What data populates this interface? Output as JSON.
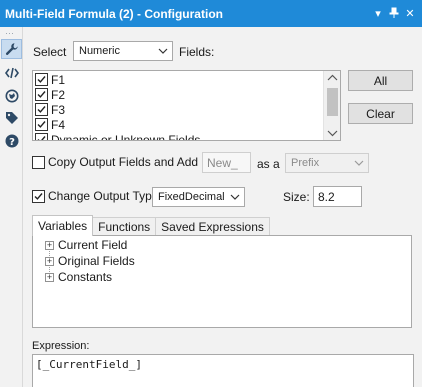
{
  "window": {
    "title": "Multi-Field Formula (2) - Configuration",
    "controls": [
      "▾",
      "⊥",
      "✕"
    ]
  },
  "sidebar": {
    "grip": "⋯",
    "icons": [
      "wrench-icon",
      "code-icon",
      "globe-icon",
      "tag-icon",
      "help-icon"
    ]
  },
  "select_row": {
    "label": "Select",
    "type_value": "Numeric",
    "fields_label": "Fields:"
  },
  "fields": {
    "items": [
      {
        "label": "F1",
        "checked": true
      },
      {
        "label": "F2",
        "checked": true
      },
      {
        "label": "F3",
        "checked": true
      },
      {
        "label": "F4",
        "checked": true
      },
      {
        "label": "Dynamic or Unknown Fields",
        "checked": true
      }
    ],
    "all_button": "All",
    "clear_button": "Clear"
  },
  "copy_output": {
    "label": "Copy Output Fields and Add",
    "checked": false,
    "text_value": "New_",
    "as_label": "as a",
    "position_value": "Prefix"
  },
  "change_type": {
    "label": "Change Output Type to",
    "checked": true,
    "type_value": "FixedDecimal",
    "size_label": "Size:",
    "size_value": "8.2"
  },
  "tabs": [
    {
      "label": "Variables",
      "active": true
    },
    {
      "label": "Functions",
      "active": false
    },
    {
      "label": "Saved Expressions",
      "active": false
    }
  ],
  "tree": [
    {
      "label": "Current Field"
    },
    {
      "label": "Original Fields"
    },
    {
      "label": "Constants"
    }
  ],
  "expression": {
    "label": "Expression:",
    "value": "[_CurrentField_]"
  },
  "colors": {
    "titlebar": "#1f8ad8",
    "active_sidebar": "#c8dcf0"
  }
}
